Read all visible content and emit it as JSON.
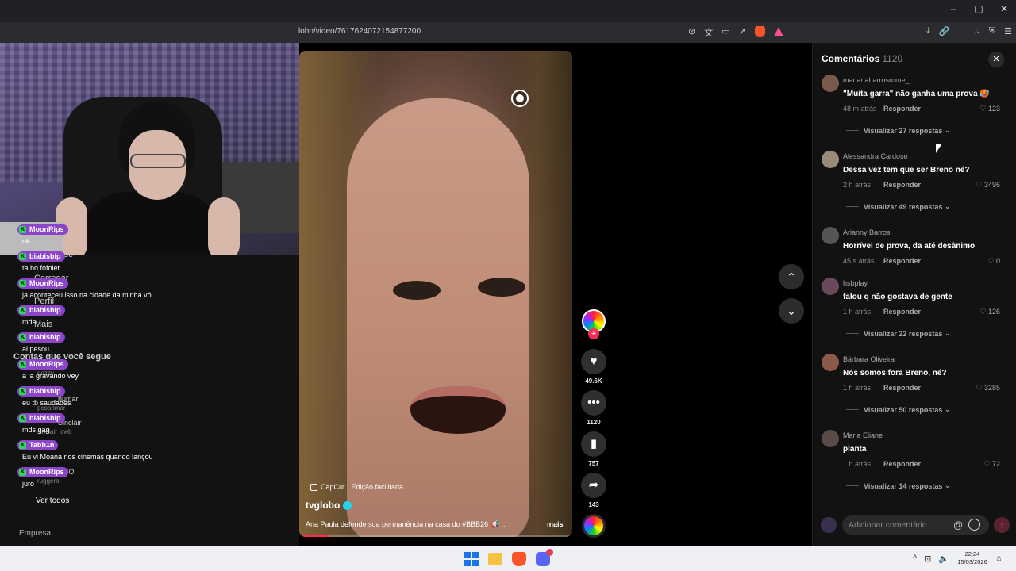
{
  "browser": {
    "url": "lobo/video/7617624072154877200",
    "window_controls": [
      "–",
      "▢",
      "✕"
    ],
    "address_icons": [
      "reader-mode-icon",
      "translate-icon",
      "screenshot-icon",
      "share-icon"
    ],
    "right_icons": [
      "download-icon",
      "link-icon",
      "music-icon",
      "shield-icon",
      "menu-icon"
    ]
  },
  "sidebar_ghost": {
    "items": [
      "gens",
      "de",
      "Carregar",
      "Perfil",
      "Mais",
      "Contas que você segue",
      "gozzy",
      "humar",
      "pcoahmar",
      "Sinclair",
      "sinclair_cwb",
      "RO",
      "ruggero",
      "Ver todos",
      "Empresa"
    ]
  },
  "chat": {
    "messages": [
      {
        "user": "MoonRips",
        "text": "ok"
      },
      {
        "user": "biabisbip",
        "text": "ta bo fofolet"
      },
      {
        "user": "MoonRips",
        "text": "ja aconteceu isso na cidade da minha vó"
      },
      {
        "user": "biabisbip",
        "text": "mds"
      },
      {
        "user": "biabisbip",
        "text": "ai pesou"
      },
      {
        "user": "MoonRips",
        "text": "a ia gravando vey"
      },
      {
        "user": "biabisbip",
        "text": "eu tb saudades"
      },
      {
        "user": "biabisbip",
        "text": "mds gag"
      },
      {
        "user": "Tabb1n",
        "text": "Eu vi Moana nos cinemas quando lançou"
      },
      {
        "user": "MoonRips",
        "text": "juro"
      }
    ],
    "ver_todos": "Ver todos",
    "empresa": "Empresa"
  },
  "video": {
    "capcut": "CapCut · Edição facilitada",
    "author": "tvglobo",
    "caption": "Ana Paula defende sua permanência na casa do #BBB26 📢 ...",
    "more": "mais",
    "progress": 0.11
  },
  "actions": {
    "follow": "+",
    "likes": "49.6K",
    "comments": "1120",
    "saves": "757",
    "shares": "143"
  },
  "nav": {
    "up": "⌃",
    "down": "⌄"
  },
  "comments_panel": {
    "title": "Comentários",
    "count": "1120",
    "close": "✕",
    "items": [
      {
        "user": "marianabarrosrome_",
        "text": "\"Muita garra\" não ganha uma prova 🥵",
        "time": "48 m atrás",
        "reply": "Responder",
        "likes": "123",
        "replies": "Visualizar 27 respostas",
        "avatar": "#7a5a4a"
      },
      {
        "user": "Alessandra Cardoso",
        "text": "Dessa vez tem que ser Breno né?",
        "time": "2 h atrás",
        "reply": "Responder",
        "likes": "3496",
        "replies": "Visualizar 49 respostas",
        "avatar": "#9a8a7a"
      },
      {
        "user": "Arianny Barros",
        "text": "Horrível de prova, da até desânimo",
        "time": "45 s atrás",
        "reply": "Responder",
        "likes": "0",
        "replies": "",
        "avatar": "#555555"
      },
      {
        "user": "hsbplay",
        "text": "falou q não gostava de gente",
        "time": "1 h atrás",
        "reply": "Responder",
        "likes": "126",
        "replies": "Visualizar 22 respostas",
        "avatar": "#6a4a5a"
      },
      {
        "user": "Bárbara Oliveira",
        "text": "Nós somos fora Breno, né?",
        "time": "1 h atrás",
        "reply": "Responder",
        "likes": "3285",
        "replies": "Visualizar 50 respostas",
        "avatar": "#8a5a4a"
      },
      {
        "user": "Maria Eliane",
        "text": "planta",
        "time": "1 h atrás",
        "reply": "Responder",
        "likes": "72",
        "replies": "Visualizar 14 respostas",
        "avatar": "#5a4a4a"
      }
    ],
    "input_placeholder": "Adicionar comentário...",
    "at": "@"
  },
  "taskbar": {
    "time": "22:24",
    "date": "15/03/2026",
    "tray": [
      "^",
      "⊡",
      "🔈"
    ]
  }
}
